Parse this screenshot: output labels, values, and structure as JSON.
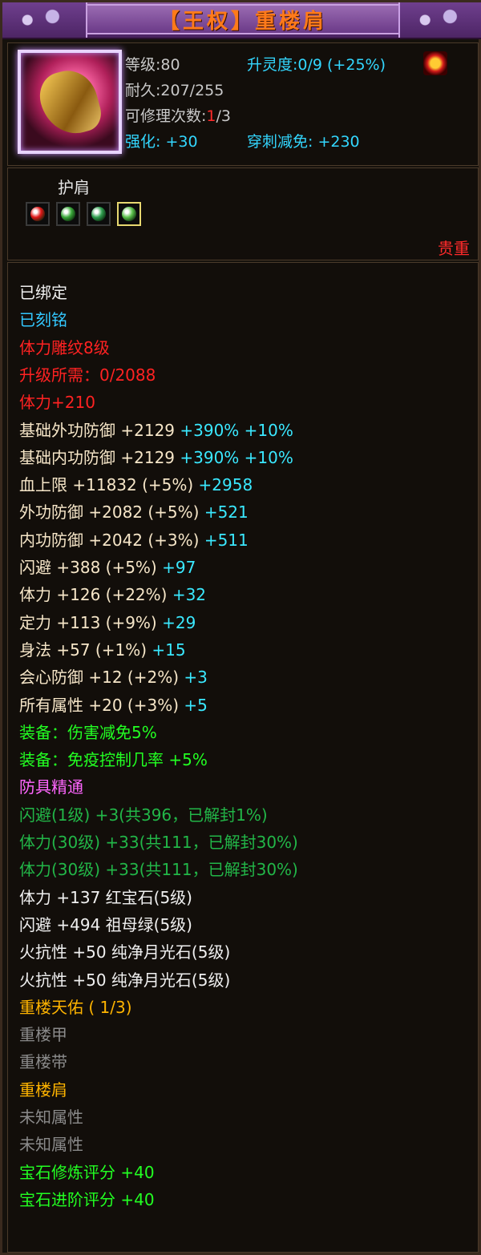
{
  "title": "【王权】重楼肩",
  "header": {
    "level": "等级:80",
    "durability": "耐久:207/255",
    "repair_prefix": "可修理次数:",
    "repair_used": "1",
    "repair_suffix": "/3",
    "refine_label": "强化: +30",
    "spirit": "升灵度:0/9 (+25%)",
    "pierce": "穿刺减免: +230"
  },
  "slot": {
    "label": "护肩",
    "rarity": "贵重",
    "gems": [
      {
        "icon": "red-gem-icon",
        "color": "#e01818"
      },
      {
        "icon": "green-gem-icon",
        "color": "#3aa83a"
      },
      {
        "icon": "green-gem-icon",
        "color": "#2f9e4f"
      },
      {
        "icon": "green-gem-icon",
        "color": "#5ac04a"
      }
    ]
  },
  "attributes": [
    {
      "text": "已绑定",
      "color": "white"
    },
    {
      "text": "已刻铭",
      "color": "blue"
    },
    {
      "text": "体力雕纹8级",
      "color": "red"
    },
    {
      "text": "升级所需：0/2088",
      "color": "red"
    },
    {
      "text": "体力+210",
      "color": "red"
    },
    {
      "base": "基础外功防御 +2129",
      "extra": " +390% +10%",
      "color": "cream"
    },
    {
      "base": "基础内功防御 +2129",
      "extra": " +390% +10%",
      "color": "cream"
    },
    {
      "base": "血上限 +11832 (+5%)",
      "extra": " +2958",
      "color": "cream"
    },
    {
      "base": "外功防御 +2082 (+5%)",
      "extra": " +521",
      "color": "cream"
    },
    {
      "base": "内功防御 +2042 (+3%)",
      "extra": " +511",
      "color": "cream"
    },
    {
      "base": "闪避 +388 (+5%)",
      "extra": " +97",
      "color": "cream"
    },
    {
      "base": "体力 +126 (+22%)",
      "extra": " +32",
      "color": "cream"
    },
    {
      "base": "定力 +113 (+9%)",
      "extra": " +29",
      "color": "cream"
    },
    {
      "base": "身法 +57 (+1%)",
      "extra": " +15",
      "color": "cream"
    },
    {
      "base": "会心防御 +12 (+2%)",
      "extra": " +3",
      "color": "cream"
    },
    {
      "base": "所有属性 +20 (+3%)",
      "extra": " +5",
      "color": "cream"
    },
    {
      "text": "装备：伤害减免5%",
      "color": "green"
    },
    {
      "text": "装备：免疫控制几率 +5%",
      "color": "green"
    },
    {
      "text": "防具精通",
      "color": "pink"
    },
    {
      "text": "闪避(1级) +3(共396，已解封1%)",
      "color": "dgreen"
    },
    {
      "text": "体力(30级) +33(共111，已解封30%)",
      "color": "dgreen"
    },
    {
      "text": "体力(30级) +33(共111，已解封30%)",
      "color": "dgreen"
    },
    {
      "text": "体力 +137 红宝石(5级)",
      "color": "white"
    },
    {
      "text": "闪避 +494 祖母绿(5级)",
      "color": "white"
    },
    {
      "text": "火抗性 +50 纯净月光石(5级)",
      "color": "white"
    },
    {
      "text": "火抗性 +50 纯净月光石(5级)",
      "color": "white"
    },
    {
      "text": "重楼天佑 ( 1/3)",
      "color": "orange"
    },
    {
      "text": "重楼甲",
      "color": "gray"
    },
    {
      "text": "重楼带",
      "color": "gray"
    },
    {
      "text": "重楼肩",
      "color": "orange"
    },
    {
      "text": "未知属性",
      "color": "gray"
    },
    {
      "text": "未知属性",
      "color": "gray"
    },
    {
      "text": "宝石修炼评分 +40",
      "color": "green"
    },
    {
      "text": "宝石进阶评分 +40",
      "color": "green"
    }
  ]
}
